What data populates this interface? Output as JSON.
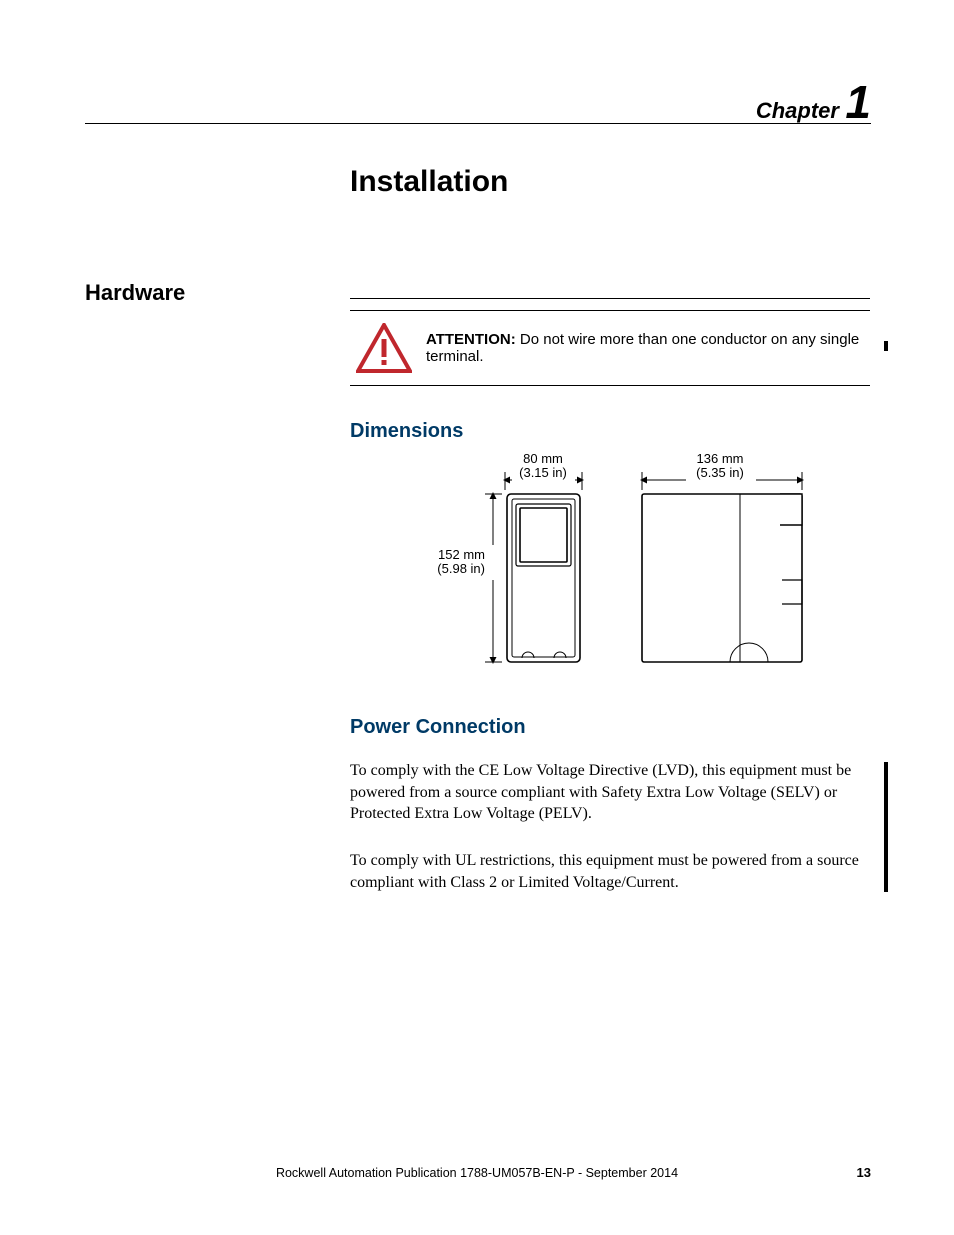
{
  "chapter": {
    "word": "Chapter",
    "number": "1"
  },
  "title": "Installation",
  "section": "Hardware",
  "attention": {
    "label": "ATTENTION:",
    "text": "  Do not wire more than one conductor on any single terminal."
  },
  "subsections": {
    "dimensions": "Dimensions",
    "power": "Power Connection"
  },
  "dims": {
    "width": {
      "mm": "80 mm",
      "in": "(3.15 in)"
    },
    "depth": {
      "mm": "136 mm",
      "in": "(5.35 in)"
    },
    "height": {
      "mm": "152 mm",
      "in": "(5.98 in)"
    }
  },
  "body": {
    "p1": "To comply with the CE Low Voltage Directive (LVD), this equipment must be powered from a source compliant with Safety Extra Low Voltage (SELV) or Protected Extra Low Voltage (PELV).",
    "p2": "To comply with UL restrictions, this equipment must be powered from a source compliant with Class 2 or Limited Voltage/Current."
  },
  "footer": "Rockwell Automation Publication 1788-UM057B-EN-P - September 2014",
  "page": "13"
}
